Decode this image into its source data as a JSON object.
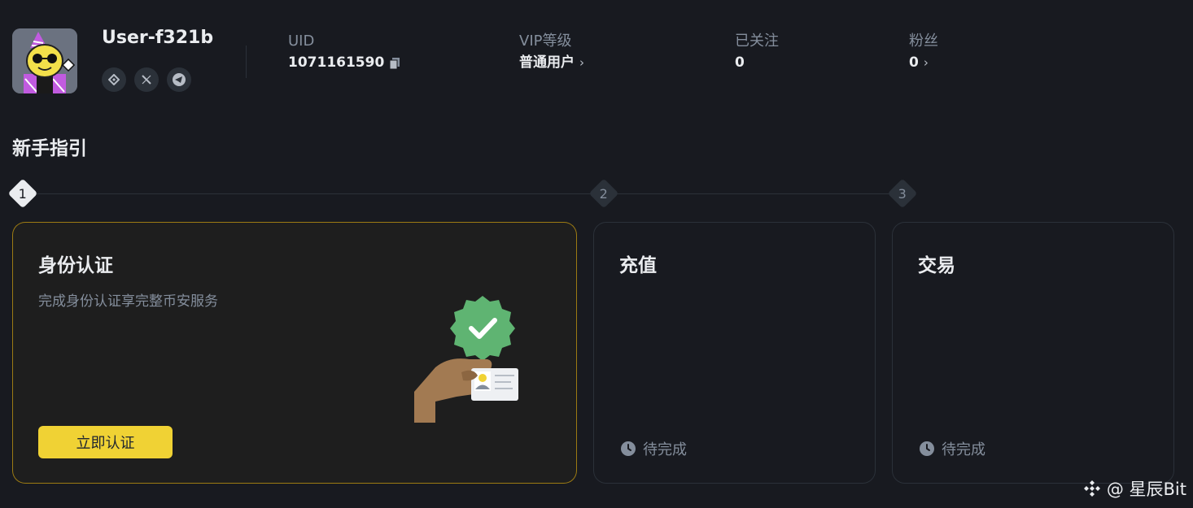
{
  "profile": {
    "username": "User-f321b",
    "social_icons": [
      "binance-icon",
      "x-icon",
      "telegram-icon"
    ]
  },
  "stats": {
    "uid": {
      "label": "UID",
      "value": "1071161590"
    },
    "vip": {
      "label": "VIP等级",
      "value": "普通用户"
    },
    "following": {
      "label": "已关注",
      "value": "0"
    },
    "followers": {
      "label": "粉丝",
      "value": "0"
    }
  },
  "guide": {
    "title": "新手指引",
    "steps": [
      {
        "number": "1",
        "state": "active"
      },
      {
        "number": "2",
        "state": "inactive"
      },
      {
        "number": "3",
        "state": "inactive"
      }
    ],
    "cards": [
      {
        "title": "身份认证",
        "description": "完成身份认证享完整币安服务",
        "button_label": "立即认证"
      },
      {
        "title": "充值",
        "status": "待完成"
      },
      {
        "title": "交易",
        "status": "待完成"
      }
    ]
  },
  "watermark": {
    "text": "@ 星辰Bit"
  },
  "colors": {
    "background": "#181a20",
    "accent": "#f0d234",
    "muted_text": "#848e9c",
    "primary_text": "#eaecef",
    "check_badge": "#5fb472"
  }
}
